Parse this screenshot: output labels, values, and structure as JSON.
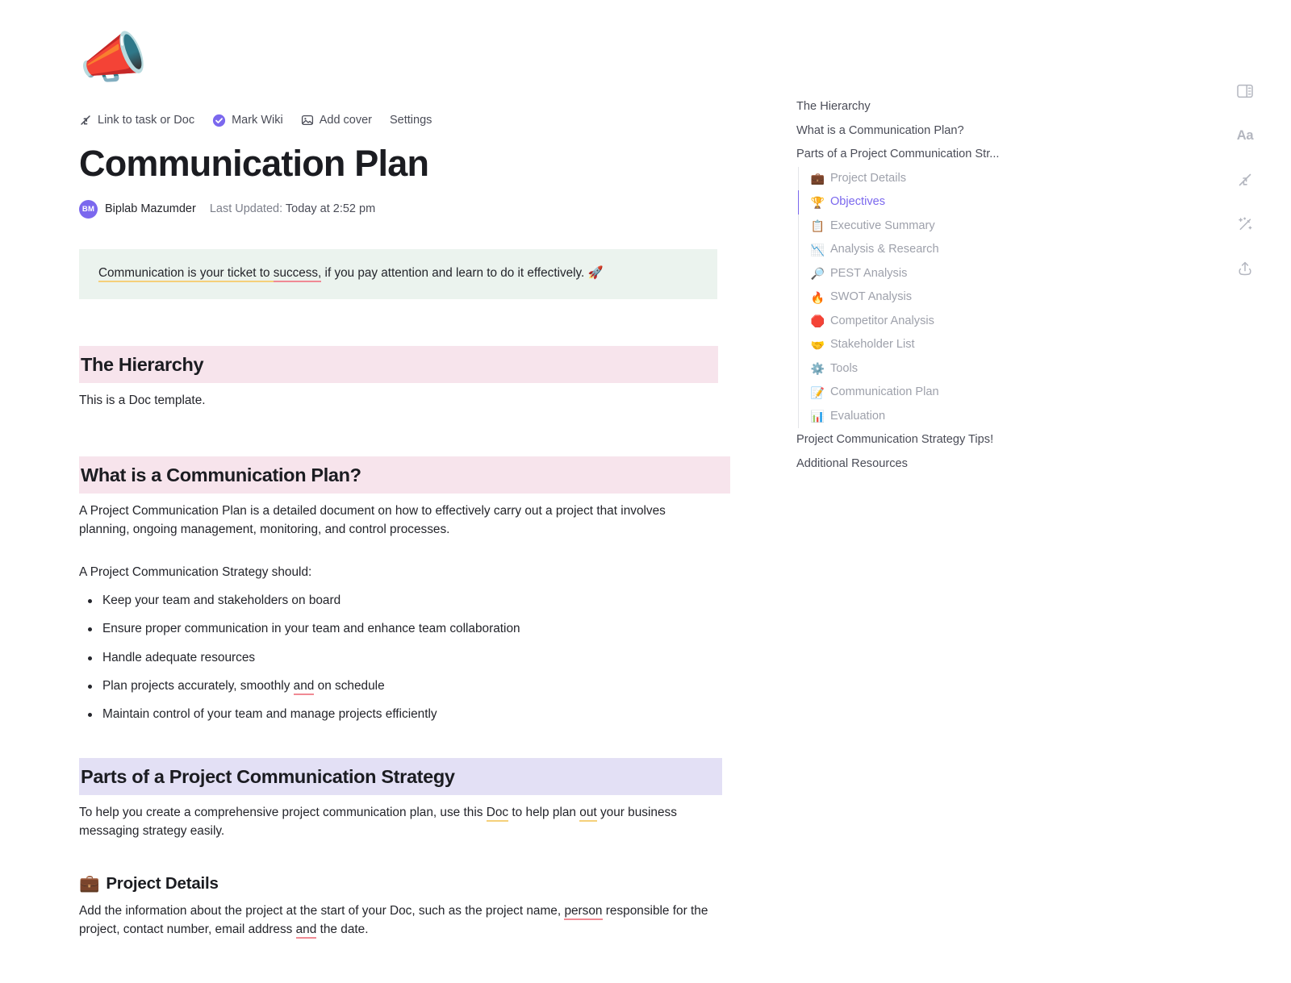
{
  "doc": {
    "icon_emoji": "📣",
    "title": "Communication Plan",
    "toolbar": [
      {
        "label": "Link to task or Doc",
        "icon": "link-arrows-icon"
      },
      {
        "label": "Mark Wiki",
        "icon": "wiki-check-badge-icon"
      },
      {
        "label": "Add cover",
        "icon": "image-icon"
      },
      {
        "label": "Settings",
        "icon": ""
      }
    ],
    "meta": {
      "avatar_initials": "BM",
      "author": "Biplab Mazumder",
      "updated_label": "Last Updated:",
      "updated_value": "Today at 2:52 pm"
    },
    "callout": {
      "part1": "Communication is your ticket to ",
      "part2": "success,",
      "part3": " if you pay attention and learn to do it effectively. ",
      "emoji": "🚀"
    }
  },
  "sections": {
    "hierarchy": {
      "heading": "The Hierarchy",
      "paragraph": "This is a Doc template."
    },
    "what_is": {
      "heading": "What is a Communication Plan?",
      "paragraph": "A Project Communication Plan is a detailed document on how to effectively carry out a project that involves planning, ongoing management, monitoring, and control processes.",
      "list_intro": "A Project Communication Strategy should:",
      "bullets": [
        {
          "text": "Keep your team and stakeholders on board"
        },
        {
          "text": "Ensure proper communication in your team and enhance team collaboration"
        },
        {
          "text": "Handle adequate resources"
        },
        {
          "pre": "Plan projects accurately, smoothly ",
          "mark": "and",
          "post": " on schedule"
        },
        {
          "text": "Maintain control of your team and manage projects efficiently"
        }
      ]
    },
    "parts": {
      "heading": "Parts of a Project Communication Strategy",
      "p_pre": "To help you create a comprehensive project communication plan, use this ",
      "p_mark1": "Doc",
      "p_mid": " to help plan ",
      "p_mark2": "out",
      "p_post": " your business messaging strategy easily."
    },
    "project_details": {
      "emoji": "💼",
      "heading": "Project Details",
      "p_pre": "Add the information about the project at the start of your Doc, such as the project name, ",
      "p_mark1": "person",
      "p_mid": " responsible for the project, contact number, email address ",
      "p_mark2": "and",
      "p_post": " the date."
    }
  },
  "outline": {
    "top_items": [
      {
        "label": "The Hierarchy"
      },
      {
        "label": "What is a Communication Plan?"
      },
      {
        "label": "Parts of a Project Communication Str..."
      }
    ],
    "children": [
      {
        "emoji": "💼",
        "label": "Project Details",
        "active": false
      },
      {
        "emoji": "🏆",
        "label": "Objectives",
        "active": true
      },
      {
        "emoji": "📋",
        "label": "Executive Summary",
        "active": false
      },
      {
        "emoji": "📉",
        "label": "Analysis & Research",
        "active": false
      },
      {
        "emoji": "🔎",
        "label": "PEST Analysis",
        "active": false
      },
      {
        "emoji": "🔥",
        "label": "SWOT Analysis",
        "active": false
      },
      {
        "emoji": "🛑",
        "label": "Competitor Analysis",
        "active": false
      },
      {
        "emoji": "🤝",
        "label": "Stakeholder List",
        "active": false
      },
      {
        "emoji": "⚙️",
        "label": "Tools",
        "active": false
      },
      {
        "emoji": "📝",
        "label": "Communication Plan",
        "active": false
      },
      {
        "emoji": "📊",
        "label": "Evaluation",
        "active": false
      }
    ],
    "bottom_items": [
      {
        "label": "Project Communication Strategy Tips!"
      },
      {
        "label": "Additional Resources"
      }
    ]
  },
  "rail": {
    "buttons": [
      {
        "name": "toggle-outline-panel-icon"
      },
      {
        "name": "font-size-icon",
        "text": "Aa"
      },
      {
        "name": "relationships-icon"
      },
      {
        "name": "ai-magic-wand-icon"
      },
      {
        "name": "share-export-icon"
      }
    ]
  },
  "colors": {
    "accent_purple": "#7b68ee",
    "heading_pink": "#f7e4ec",
    "heading_purple": "#e3e0f5",
    "callout_green": "#ebf3ee",
    "underline_yellow": "#f5d07a",
    "underline_red": "#f08a94"
  }
}
